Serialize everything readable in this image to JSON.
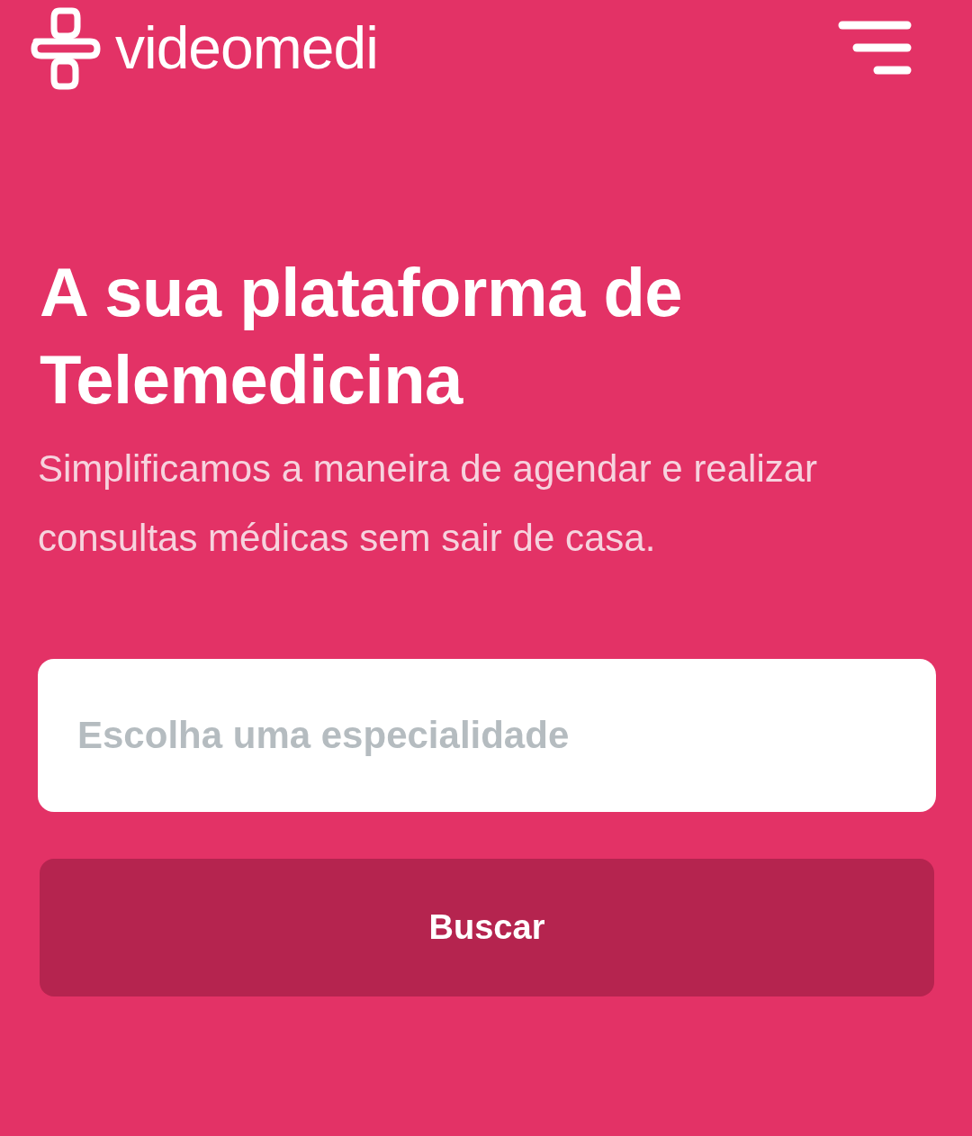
{
  "header": {
    "brand": "videomedi"
  },
  "hero": {
    "title": "A sua plataforma de Telemedicina",
    "subtitle": "Simplificamos a maneira de agendar e realizar consultas médicas sem sair de casa."
  },
  "search": {
    "placeholder": "Escolha uma especialidade",
    "button": "Buscar"
  }
}
